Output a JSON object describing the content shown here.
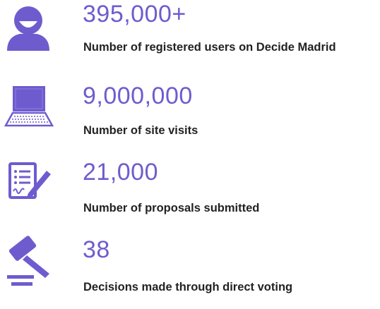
{
  "accent_color": "#6e5ccf",
  "stats": [
    {
      "icon": "user-icon",
      "value": "395,000+",
      "label": "Number of registered users on Decide Madrid"
    },
    {
      "icon": "laptop-icon",
      "value": "9,000,000",
      "label": "Number of site visits"
    },
    {
      "icon": "signed-document-icon",
      "value": "21,000",
      "label": "Number of proposals submitted"
    },
    {
      "icon": "gavel-icon",
      "value": "38",
      "label": "Decisions made through direct voting"
    }
  ]
}
